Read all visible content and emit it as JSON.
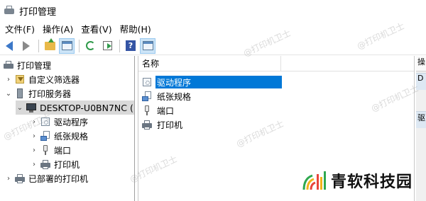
{
  "window": {
    "title": "打印管理"
  },
  "menu": [
    "文件(F)",
    "操作(A)",
    "查看(V)",
    "帮助(H)"
  ],
  "toolbar": {
    "buttons": [
      "back-icon",
      "forward-icon",
      "up-folder-icon",
      "show-hide-console-tree-icon",
      "refresh-icon",
      "export-list-icon",
      "help-icon",
      "show-hide-action-pane-icon"
    ]
  },
  "tree": {
    "root": "打印管理",
    "items": [
      {
        "label": "自定义筛选器",
        "expander": "›"
      },
      {
        "label": "打印服务器",
        "expander": "⌄"
      },
      {
        "label": "DESKTOP-U0BN7NC (",
        "expander": "⌄"
      },
      {
        "label": "驱动程序",
        "expander": "›"
      },
      {
        "label": "纸张规格",
        "expander": "›"
      },
      {
        "label": "端口",
        "expander": "›"
      },
      {
        "label": "打印机",
        "expander": "›"
      },
      {
        "label": "已部署的打印机",
        "expander": "›"
      }
    ]
  },
  "list": {
    "header": "名称",
    "rows": [
      "驱动程序",
      "纸张规格",
      "端口",
      "打印机"
    ],
    "selected_index": 0
  },
  "actions": {
    "header": "操",
    "items": [
      "D",
      "驱"
    ]
  },
  "watermark": "@打印机卫士",
  "brand": {
    "name": "青软科技园"
  },
  "colors": {
    "selection": "#0078d7",
    "tree_selection": "#d9d9d9"
  }
}
